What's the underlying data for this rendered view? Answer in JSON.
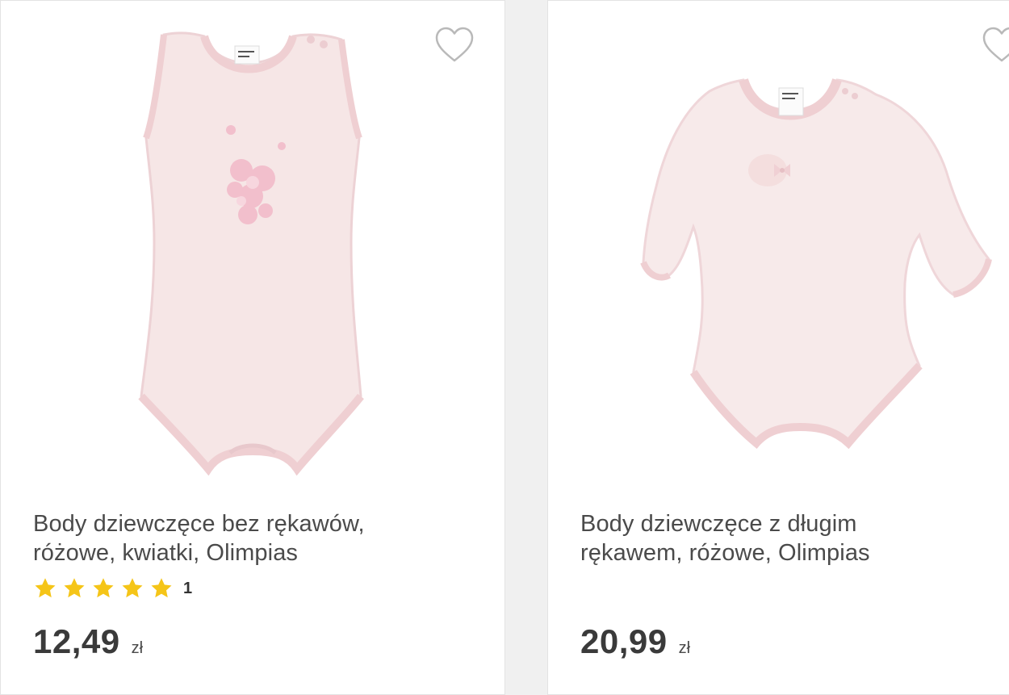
{
  "products": [
    {
      "title_line1": "Body dziewczęce bez rękawów,",
      "title_line2": "różowe, kwiatki, Olimpias",
      "rating": {
        "stars": 5,
        "count": "1"
      },
      "price": "12,49",
      "currency": "zł",
      "image": "sleeveless-pink-bodysuit"
    },
    {
      "title_line1": "Body dziewczęce z długim",
      "title_line2": "rękawem, różowe, Olimpias",
      "price": "20,99",
      "currency": "zł",
      "image": "long-sleeve-pink-bodysuit"
    }
  ],
  "icons": {
    "favorite": "heart-outline-icon",
    "rating_star": "star-filled-icon"
  },
  "colors": {
    "star": "#f5c518",
    "garment": "#f6e6e6",
    "garment_trim": "#efcfd2"
  }
}
